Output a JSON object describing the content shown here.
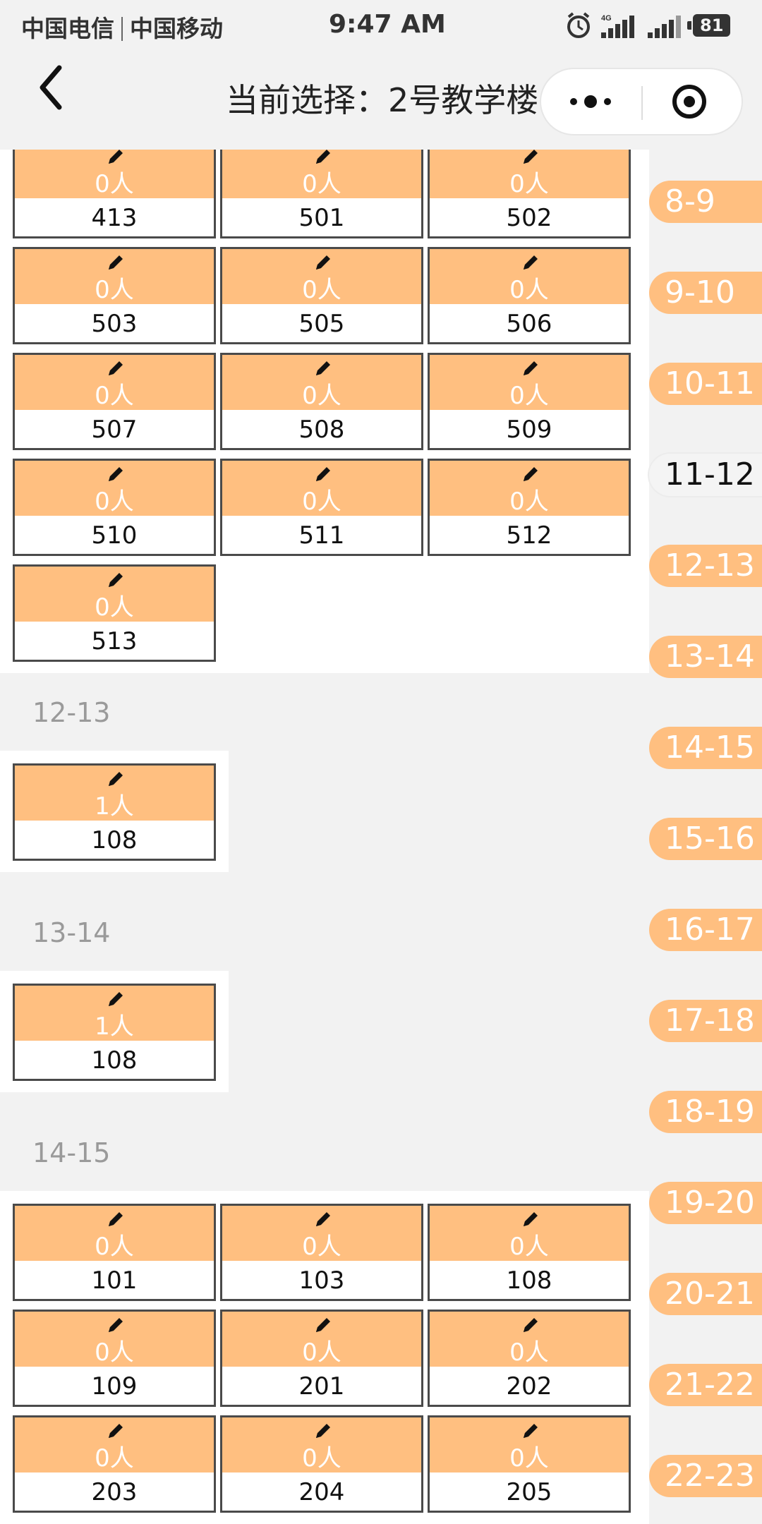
{
  "status_bar": {
    "carrier1": "中国电信",
    "carrier2": "中国移动",
    "time": "9:47 AM",
    "net_label": "4G",
    "battery": "81"
  },
  "nav": {
    "title": "当前选择：2号教学楼"
  },
  "colors": {
    "accent": "#ffbf80",
    "background": "#f2f2f2"
  },
  "groups": [
    {
      "heading": "",
      "rooms": [
        {
          "count": "0人",
          "room": "413"
        },
        {
          "count": "0人",
          "room": "501"
        },
        {
          "count": "0人",
          "room": "502"
        },
        {
          "count": "0人",
          "room": "503"
        },
        {
          "count": "0人",
          "room": "505"
        },
        {
          "count": "0人",
          "room": "506"
        },
        {
          "count": "0人",
          "room": "507"
        },
        {
          "count": "0人",
          "room": "508"
        },
        {
          "count": "0人",
          "room": "509"
        },
        {
          "count": "0人",
          "room": "510"
        },
        {
          "count": "0人",
          "room": "511"
        },
        {
          "count": "0人",
          "room": "512"
        },
        {
          "count": "0人",
          "room": "513"
        }
      ]
    },
    {
      "heading": "12-13",
      "rooms": [
        {
          "count": "1人",
          "room": "108"
        }
      ]
    },
    {
      "heading": "13-14",
      "rooms": [
        {
          "count": "1人",
          "room": "108"
        }
      ]
    },
    {
      "heading": "14-15",
      "rooms": [
        {
          "count": "0人",
          "room": "101"
        },
        {
          "count": "0人",
          "room": "103"
        },
        {
          "count": "0人",
          "room": "108"
        },
        {
          "count": "0人",
          "room": "109"
        },
        {
          "count": "0人",
          "room": "201"
        },
        {
          "count": "0人",
          "room": "202"
        },
        {
          "count": "0人",
          "room": "203"
        },
        {
          "count": "0人",
          "room": "204"
        },
        {
          "count": "0人",
          "room": "205"
        }
      ]
    }
  ],
  "time_rail": {
    "active": "11-12",
    "items": [
      "8-9",
      "9-10",
      "10-11",
      "11-12",
      "12-13",
      "13-14",
      "14-15",
      "15-16",
      "16-17",
      "17-18",
      "18-19",
      "19-20",
      "20-21",
      "21-22",
      "22-23"
    ]
  }
}
